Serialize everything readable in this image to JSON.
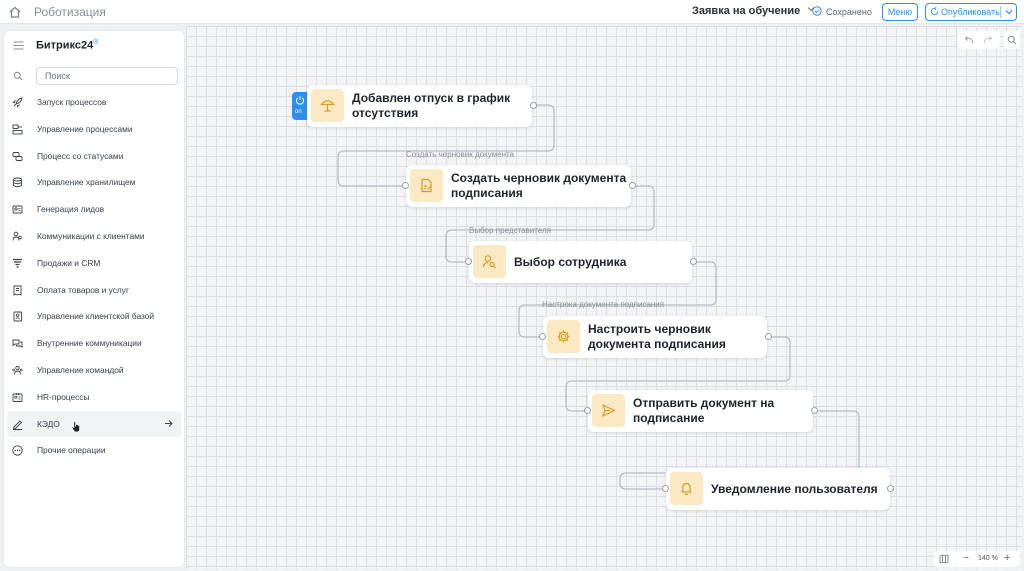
{
  "topbar": {
    "app_title": "Роботизация",
    "flow_name": "Заявка на обучение",
    "saved_status": "Сохранено",
    "menu_label": "Меню",
    "publish_label": "Опубликовать",
    "accent_color": "#2f8ff0"
  },
  "sidebar": {
    "brand": "Битрикс24",
    "brand_mark": "®",
    "search_placeholder": "Поиск",
    "items": [
      {
        "label": "Запуск процессов",
        "icon": "rocket-icon"
      },
      {
        "label": "Управление процессами",
        "icon": "process-blocks-icon"
      },
      {
        "label": "Процесс со статусами",
        "icon": "status-flow-icon"
      },
      {
        "label": "Управление хранилищем",
        "icon": "database-icon"
      },
      {
        "label": "Генерация лидов",
        "icon": "lead-card-icon"
      },
      {
        "label": "Коммуникации с клиентами",
        "icon": "people-icon"
      },
      {
        "label": "Продажи и CRM",
        "icon": "funnel-icon"
      },
      {
        "label": "Оплата товаров и услуг",
        "icon": "receipt-icon"
      },
      {
        "label": "Управление клиентской базой",
        "icon": "contact-book-icon"
      },
      {
        "label": "Внутренние коммуникации",
        "icon": "chat-icon"
      },
      {
        "label": "Управление командой",
        "icon": "team-icon"
      },
      {
        "label": "HR-процессы",
        "icon": "hr-badge-icon"
      },
      {
        "label": "КЭДО",
        "icon": "pen-sign-icon",
        "active": true
      },
      {
        "label": "Прочие операции",
        "icon": "more-dots-icon"
      }
    ]
  },
  "canvas": {
    "trigger_state": "on",
    "zoom": "140 %",
    "nodes": [
      {
        "title_line1": "Добавлен отпуск в график",
        "title_line2": "отсутствия",
        "icon": "vacation-umbrella-icon"
      },
      {
        "title_line1": "Создать черновик документа",
        "title_line2": "подписания",
        "icon": "document-edit-icon"
      },
      {
        "title_line1": "Выбор сотрудника",
        "title_line2": "",
        "icon": "user-search-icon"
      },
      {
        "title_line1": "Настроить черновик",
        "title_line2": "документа подписания",
        "icon": "settings-gear-icon"
      },
      {
        "title_line1": "Отправить документ на",
        "title_line2": "подписание",
        "icon": "send-arrow-icon"
      },
      {
        "title_line1": "Уведомление пользователя",
        "title_line2": "",
        "icon": "bell-icon"
      }
    ],
    "edge_labels": [
      "Создать черновик документа",
      "Выбор представителя",
      "Настрока документа подписания"
    ]
  }
}
